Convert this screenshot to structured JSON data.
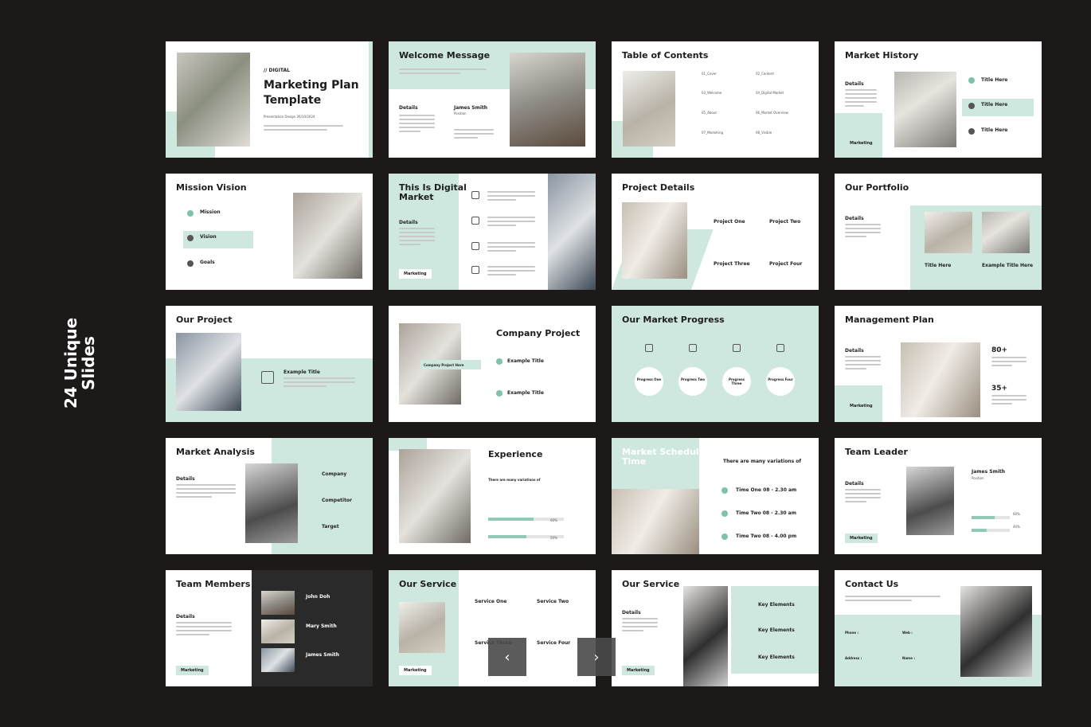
{
  "side_label": {
    "line1": "24 Unique",
    "line2": "Slides"
  },
  "slides": {
    "s1": {
      "kicker": "// DIGITAL",
      "title1": "Marketing Plan",
      "title2": "Template",
      "sub": "Presentation Design 26/10/2024"
    },
    "s2": {
      "title": "Welcome Message",
      "details": "Details",
      "name": "James Smith",
      "position": "Position"
    },
    "s3": {
      "title": "Table of Contents",
      "items": [
        "01_Cover",
        "02_Content",
        "03_Welcome",
        "04_Digital Market",
        "05_About",
        "06_Market Overview",
        "07_Marketing",
        "08_Visible"
      ]
    },
    "s4": {
      "title": "Market History",
      "details": "Details",
      "pill": "Marketing",
      "items": [
        "Title Here",
        "Title Here",
        "Title Here"
      ]
    },
    "s5": {
      "title": "Mission Vision",
      "items": [
        "Mission",
        "Vision",
        "Goals"
      ]
    },
    "s6": {
      "title1": "This Is Digital",
      "title2": "Market",
      "details": "Details",
      "pill": "Marketing"
    },
    "s7": {
      "title": "Project Details",
      "items": [
        "Project One",
        "Project Two",
        "Project Three",
        "Project Four"
      ]
    },
    "s8": {
      "title": "Our Portfolio",
      "details": "Details",
      "cap1": "Title Here",
      "cap2": "Example Title Here"
    },
    "s9": {
      "title": "Our Project",
      "item": "Example Title"
    },
    "s10": {
      "title": "Company Project",
      "banner": "Company Project Here",
      "items": [
        "Example Title",
        "Example Title"
      ]
    },
    "s11": {
      "title": "Our Market Progress",
      "items": [
        "Progress One",
        "Progress Two",
        "Progress Three",
        "Progress Four"
      ]
    },
    "s12": {
      "title": "Management Plan",
      "details": "Details",
      "pill": "Marketing",
      "stat1": "80+",
      "stat2": "35+"
    },
    "s13": {
      "title": "Market Analysis",
      "details": "Details",
      "items": [
        "Company",
        "Competitor",
        "Target"
      ]
    },
    "s14": {
      "title": "Experience",
      "sub": "There are many variations of",
      "bars": [
        {
          "label": "60%",
          "value": 0.6
        },
        {
          "label": "50%",
          "value": 0.5
        }
      ]
    },
    "s15": {
      "title1": "Market Schedule",
      "title2": "Time",
      "sub": "There are many variations of",
      "items": [
        "Time One 08 - 2.30 am",
        "Time Two 08 - 2.30 am",
        "Time Two 08 - 4.00 pm"
      ]
    },
    "s16": {
      "title": "Team Leader",
      "details": "Details",
      "pill": "Marketing",
      "name": "James Smith",
      "position": "Position",
      "bars": [
        {
          "label": "60%",
          "value": 0.6
        },
        {
          "label": "40%",
          "value": 0.4
        }
      ]
    },
    "s17": {
      "title": "Team Members",
      "details": "Details",
      "pill": "Marketing",
      "members": [
        "John Doh",
        "Mary Smith",
        "James Smith"
      ]
    },
    "s18": {
      "title": "Our Service",
      "pill": "Marketing",
      "items": [
        "Service One",
        "Service Two",
        "Service Three",
        "Service Four"
      ]
    },
    "s19": {
      "title": "Our Service",
      "details": "Details",
      "pill": "Marketing",
      "items": [
        "Key Elements",
        "Key Elements",
        "Key Elements"
      ]
    },
    "s20": {
      "title": "Contact Us",
      "labels": [
        "Phone :",
        "Web :",
        "Address :",
        "Name :"
      ]
    }
  },
  "nav": {
    "prev": "‹",
    "next": "›"
  },
  "colors": {
    "background": "#1c1918",
    "accent": "#cfe8df",
    "accent_dark": "#7fc1ab"
  }
}
